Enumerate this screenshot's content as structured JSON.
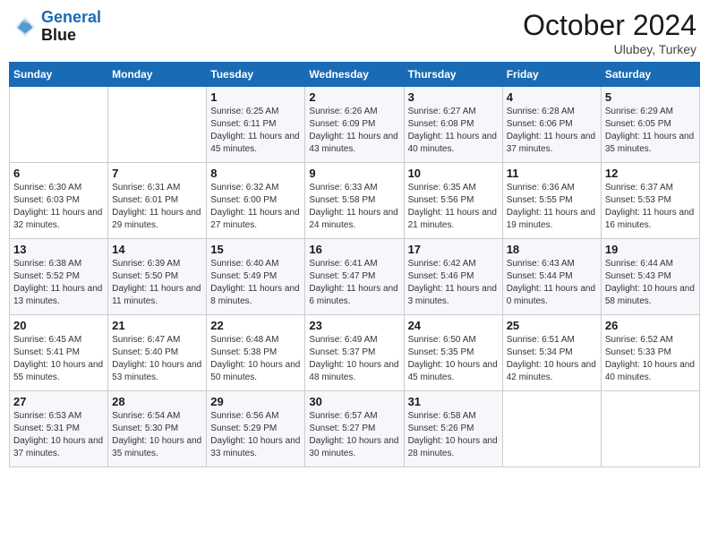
{
  "header": {
    "logo_line1": "General",
    "logo_line2": "Blue",
    "month": "October 2024",
    "location": "Ulubey, Turkey"
  },
  "weekdays": [
    "Sunday",
    "Monday",
    "Tuesday",
    "Wednesday",
    "Thursday",
    "Friday",
    "Saturday"
  ],
  "weeks": [
    [
      {
        "day": "",
        "info": ""
      },
      {
        "day": "",
        "info": ""
      },
      {
        "day": "1",
        "info": "Sunrise: 6:25 AM\nSunset: 6:11 PM\nDaylight: 11 hours and 45 minutes."
      },
      {
        "day": "2",
        "info": "Sunrise: 6:26 AM\nSunset: 6:09 PM\nDaylight: 11 hours and 43 minutes."
      },
      {
        "day": "3",
        "info": "Sunrise: 6:27 AM\nSunset: 6:08 PM\nDaylight: 11 hours and 40 minutes."
      },
      {
        "day": "4",
        "info": "Sunrise: 6:28 AM\nSunset: 6:06 PM\nDaylight: 11 hours and 37 minutes."
      },
      {
        "day": "5",
        "info": "Sunrise: 6:29 AM\nSunset: 6:05 PM\nDaylight: 11 hours and 35 minutes."
      }
    ],
    [
      {
        "day": "6",
        "info": "Sunrise: 6:30 AM\nSunset: 6:03 PM\nDaylight: 11 hours and 32 minutes."
      },
      {
        "day": "7",
        "info": "Sunrise: 6:31 AM\nSunset: 6:01 PM\nDaylight: 11 hours and 29 minutes."
      },
      {
        "day": "8",
        "info": "Sunrise: 6:32 AM\nSunset: 6:00 PM\nDaylight: 11 hours and 27 minutes."
      },
      {
        "day": "9",
        "info": "Sunrise: 6:33 AM\nSunset: 5:58 PM\nDaylight: 11 hours and 24 minutes."
      },
      {
        "day": "10",
        "info": "Sunrise: 6:35 AM\nSunset: 5:56 PM\nDaylight: 11 hours and 21 minutes."
      },
      {
        "day": "11",
        "info": "Sunrise: 6:36 AM\nSunset: 5:55 PM\nDaylight: 11 hours and 19 minutes."
      },
      {
        "day": "12",
        "info": "Sunrise: 6:37 AM\nSunset: 5:53 PM\nDaylight: 11 hours and 16 minutes."
      }
    ],
    [
      {
        "day": "13",
        "info": "Sunrise: 6:38 AM\nSunset: 5:52 PM\nDaylight: 11 hours and 13 minutes."
      },
      {
        "day": "14",
        "info": "Sunrise: 6:39 AM\nSunset: 5:50 PM\nDaylight: 11 hours and 11 minutes."
      },
      {
        "day": "15",
        "info": "Sunrise: 6:40 AM\nSunset: 5:49 PM\nDaylight: 11 hours and 8 minutes."
      },
      {
        "day": "16",
        "info": "Sunrise: 6:41 AM\nSunset: 5:47 PM\nDaylight: 11 hours and 6 minutes."
      },
      {
        "day": "17",
        "info": "Sunrise: 6:42 AM\nSunset: 5:46 PM\nDaylight: 11 hours and 3 minutes."
      },
      {
        "day": "18",
        "info": "Sunrise: 6:43 AM\nSunset: 5:44 PM\nDaylight: 11 hours and 0 minutes."
      },
      {
        "day": "19",
        "info": "Sunrise: 6:44 AM\nSunset: 5:43 PM\nDaylight: 10 hours and 58 minutes."
      }
    ],
    [
      {
        "day": "20",
        "info": "Sunrise: 6:45 AM\nSunset: 5:41 PM\nDaylight: 10 hours and 55 minutes."
      },
      {
        "day": "21",
        "info": "Sunrise: 6:47 AM\nSunset: 5:40 PM\nDaylight: 10 hours and 53 minutes."
      },
      {
        "day": "22",
        "info": "Sunrise: 6:48 AM\nSunset: 5:38 PM\nDaylight: 10 hours and 50 minutes."
      },
      {
        "day": "23",
        "info": "Sunrise: 6:49 AM\nSunset: 5:37 PM\nDaylight: 10 hours and 48 minutes."
      },
      {
        "day": "24",
        "info": "Sunrise: 6:50 AM\nSunset: 5:35 PM\nDaylight: 10 hours and 45 minutes."
      },
      {
        "day": "25",
        "info": "Sunrise: 6:51 AM\nSunset: 5:34 PM\nDaylight: 10 hours and 42 minutes."
      },
      {
        "day": "26",
        "info": "Sunrise: 6:52 AM\nSunset: 5:33 PM\nDaylight: 10 hours and 40 minutes."
      }
    ],
    [
      {
        "day": "27",
        "info": "Sunrise: 6:53 AM\nSunset: 5:31 PM\nDaylight: 10 hours and 37 minutes."
      },
      {
        "day": "28",
        "info": "Sunrise: 6:54 AM\nSunset: 5:30 PM\nDaylight: 10 hours and 35 minutes."
      },
      {
        "day": "29",
        "info": "Sunrise: 6:56 AM\nSunset: 5:29 PM\nDaylight: 10 hours and 33 minutes."
      },
      {
        "day": "30",
        "info": "Sunrise: 6:57 AM\nSunset: 5:27 PM\nDaylight: 10 hours and 30 minutes."
      },
      {
        "day": "31",
        "info": "Sunrise: 6:58 AM\nSunset: 5:26 PM\nDaylight: 10 hours and 28 minutes."
      },
      {
        "day": "",
        "info": ""
      },
      {
        "day": "",
        "info": ""
      }
    ]
  ]
}
